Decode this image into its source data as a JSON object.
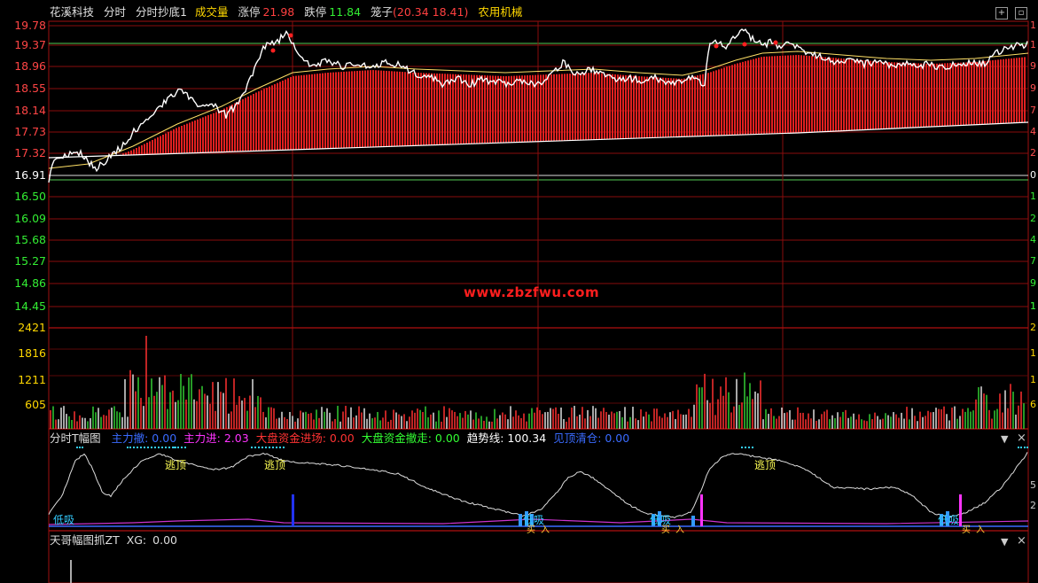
{
  "header": {
    "stock_name": "花溪科技",
    "period": "分时",
    "indicator": "分时抄底1",
    "volume_label": "成交量",
    "limit_up_label": "涨停",
    "limit_up_value": "21.98",
    "limit_down_label": "跌停",
    "limit_down_value": "11.84",
    "cage_label": "笼子",
    "cage_value": "(20.34 18.41)",
    "sector": "农用机械"
  },
  "price_axis": [
    "19.78",
    "19.37",
    "18.96",
    "18.55",
    "18.14",
    "17.73",
    "17.32",
    "16.91",
    "16.50",
    "16.09",
    "15.68",
    "15.27",
    "14.86",
    "14.45"
  ],
  "volume_axis": [
    "2421",
    "1816",
    "1211",
    "605"
  ],
  "right_axis": {
    "price": [
      "1",
      "1",
      "9",
      "9",
      "7",
      "4",
      "2",
      "0",
      "1",
      "2",
      "4",
      "7",
      "9",
      "1",
      "1"
    ],
    "volume": [
      "2",
      "1",
      "1",
      "6"
    ],
    "indicator": [
      "5",
      "2"
    ]
  },
  "watermark": "www.zbzfwu.com",
  "indicator_panel": {
    "name": "分时T幅图",
    "fields": [
      {
        "label": "主力撤:",
        "value": "0.00",
        "color": "#3a6bff"
      },
      {
        "label": "主力进:",
        "value": "2.03",
        "color": "#ff33ff"
      },
      {
        "label": "大盘资金进场:",
        "value": "0.00",
        "color": "#ff3333"
      },
      {
        "label": "大盘资金撤走:",
        "value": "0.00",
        "color": "#33ff33"
      },
      {
        "label": "趋势线:",
        "value": "100.34",
        "color": "#ffffff"
      },
      {
        "label": "见顶清仓:",
        "value": "0.00",
        "color": "#3a6bff"
      }
    ],
    "annotations": [
      "逃顶",
      "逃顶",
      "逃顶",
      "低吸",
      "低吸",
      "低吸",
      "低吸"
    ],
    "markers": [
      "买",
      "入",
      "买",
      "入",
      "买",
      "入"
    ]
  },
  "bottom_panel": {
    "name": "天哥幅图抓ZT",
    "field_label": "XG:",
    "field_value": "0.00"
  },
  "icons": [
    "plus-icon",
    "square-icon",
    "dropdown-icon",
    "close-icon"
  ],
  "colors": {
    "rise": "#ff3232",
    "fall": "#33cc33",
    "grid": "#a01010",
    "price_line": "#ffffff",
    "avg_line": "#ffffff"
  }
}
